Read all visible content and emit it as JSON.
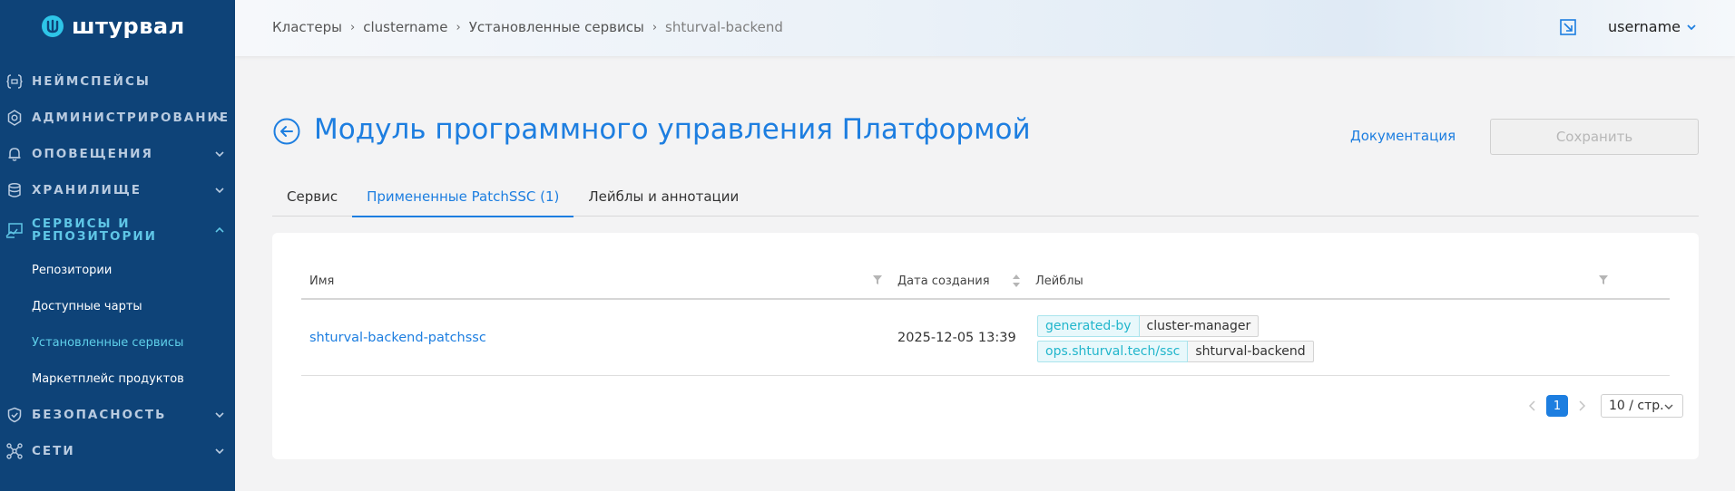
{
  "brand": {
    "name": "штурвал"
  },
  "colors": {
    "sidebar": "#0e4378",
    "accent": "#1d7ee0",
    "active_nav": "#5fc6e6",
    "label_key": "#22b6cc"
  },
  "sidebar": {
    "items": [
      {
        "label": "НЕЙМСПЕЙСЫ",
        "icon": "namespace-icon"
      },
      {
        "label": "АДМИНИСТРИРОВАНИЕ",
        "icon": "gear-icon"
      },
      {
        "label": "ОПОВЕЩЕНИЯ",
        "icon": "bell-icon"
      },
      {
        "label": "ХРАНИЛИЩЕ",
        "icon": "database-icon"
      },
      {
        "label_line1": "СЕРВИСЫ И",
        "label_line2": "РЕПОЗИТОРИИ",
        "icon": "services-icon"
      },
      {
        "label": "БЕЗОПАСНОСТЬ",
        "icon": "shield-icon"
      },
      {
        "label": "СЕТИ",
        "icon": "network-icon"
      }
    ],
    "sub_items": [
      {
        "label": "Репозитории"
      },
      {
        "label": "Доступные чарты"
      },
      {
        "label": "Установленные сервисы"
      },
      {
        "label": "Маркетплейс продуктов"
      }
    ]
  },
  "header": {
    "breadcrumbs": [
      "Кластеры",
      "clustername",
      "Установленные сервисы",
      "shturval-backend"
    ],
    "username": "username"
  },
  "page": {
    "title": "Модуль программного управления Платформой",
    "doc_link": "Документация",
    "save_label": "Сохранить"
  },
  "tabs": [
    {
      "label": "Сервис"
    },
    {
      "label": "Примененные PatchSSC (1)"
    },
    {
      "label": "Лейблы и аннотации"
    }
  ],
  "table": {
    "columns": [
      "Имя",
      "Дата создания",
      "Лейблы"
    ],
    "rows": [
      {
        "name": "shturval-backend-patchssc",
        "date": "2025-12-05 13:39",
        "labels": [
          {
            "key": "generated-by",
            "value": "cluster-manager"
          },
          {
            "key": "ops.shturval.tech/ssc",
            "value": "shturval-backend"
          }
        ]
      }
    ]
  },
  "pagination": {
    "current_page": "1",
    "page_size": "10 / стр."
  }
}
